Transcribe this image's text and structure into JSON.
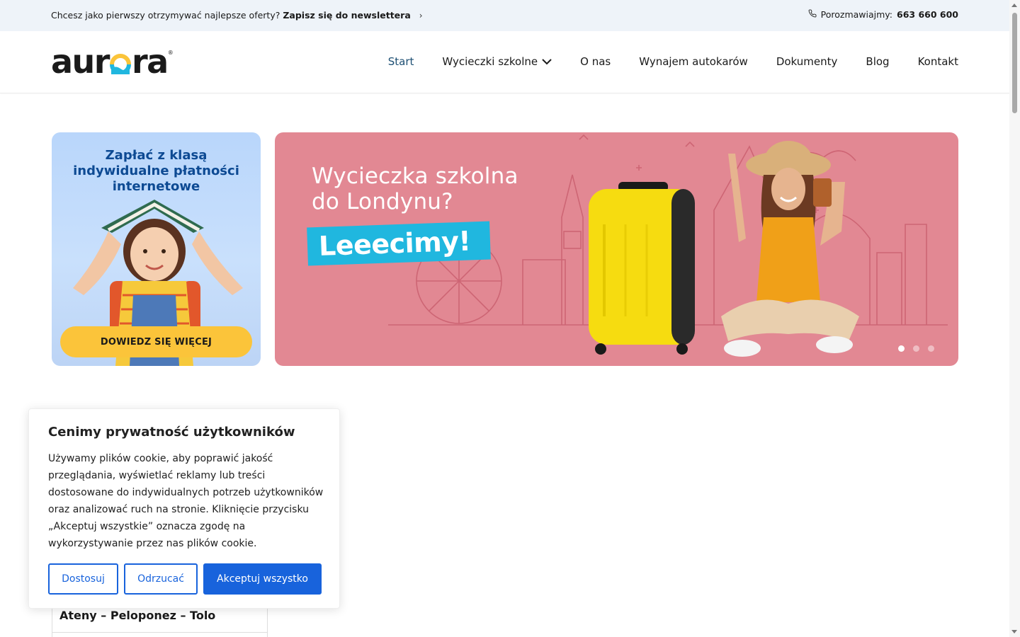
{
  "topbar": {
    "newsletter_text": "Chcesz jako pierwszy otrzymywać najlepsze oferty?",
    "newsletter_link": "Zapisz się do newslettera",
    "contact_label": "Porozmawiajmy:",
    "contact_phone": "663 660 600",
    "icons": [
      "phone-icon",
      "chevron-right-icon"
    ]
  },
  "header": {
    "logo_text": "aurora",
    "logo_reg": "®",
    "nav": [
      {
        "label": "Start",
        "active": true
      },
      {
        "label": "Wycieczki szkolne",
        "has_dropdown": true
      },
      {
        "label": "O nas"
      },
      {
        "label": "Wynajem autokarów"
      },
      {
        "label": "Dokumenty"
      },
      {
        "label": "Blog"
      },
      {
        "label": "Kontakt"
      }
    ]
  },
  "promo": {
    "title_line1": "Zapłać z klasą",
    "title_line2": "indywidualne płatności",
    "title_line3": "internetowe",
    "button": "DOWIEDZ SIĘ WIĘCEJ",
    "bg": "#c0d9fb",
    "title_color": "#0d4a93",
    "button_color": "#fbc43a"
  },
  "hero": {
    "title_line1": "Wycieczka szkolna",
    "title_line2": "do Londynu?",
    "tag": "Leeecimy!",
    "slides": 3,
    "active_slide": 1,
    "bg": "#e28893",
    "tag_color": "#20b7df"
  },
  "cookie": {
    "title": "Cenimy prywatność użytkowników",
    "body": "Używamy plików cookie, aby poprawić jakość przeglądania, wyświetlać reklamy lub treści dostosowane do indywidualnych potrzeb użytkowników oraz analizować ruch na stronie. Kliknięcie przycisku „Akceptuj wszystkie” oznacza zgodę na wykorzystywanie przez nas plików cookie.",
    "btn_customize": "Dostosuj",
    "btn_reject": "Odrzucać",
    "btn_accept": "Akceptuj wszystko",
    "accent": "#1863dc"
  },
  "trips": {
    "items": [
      "Ateny – Peloponez – Tolo"
    ]
  }
}
